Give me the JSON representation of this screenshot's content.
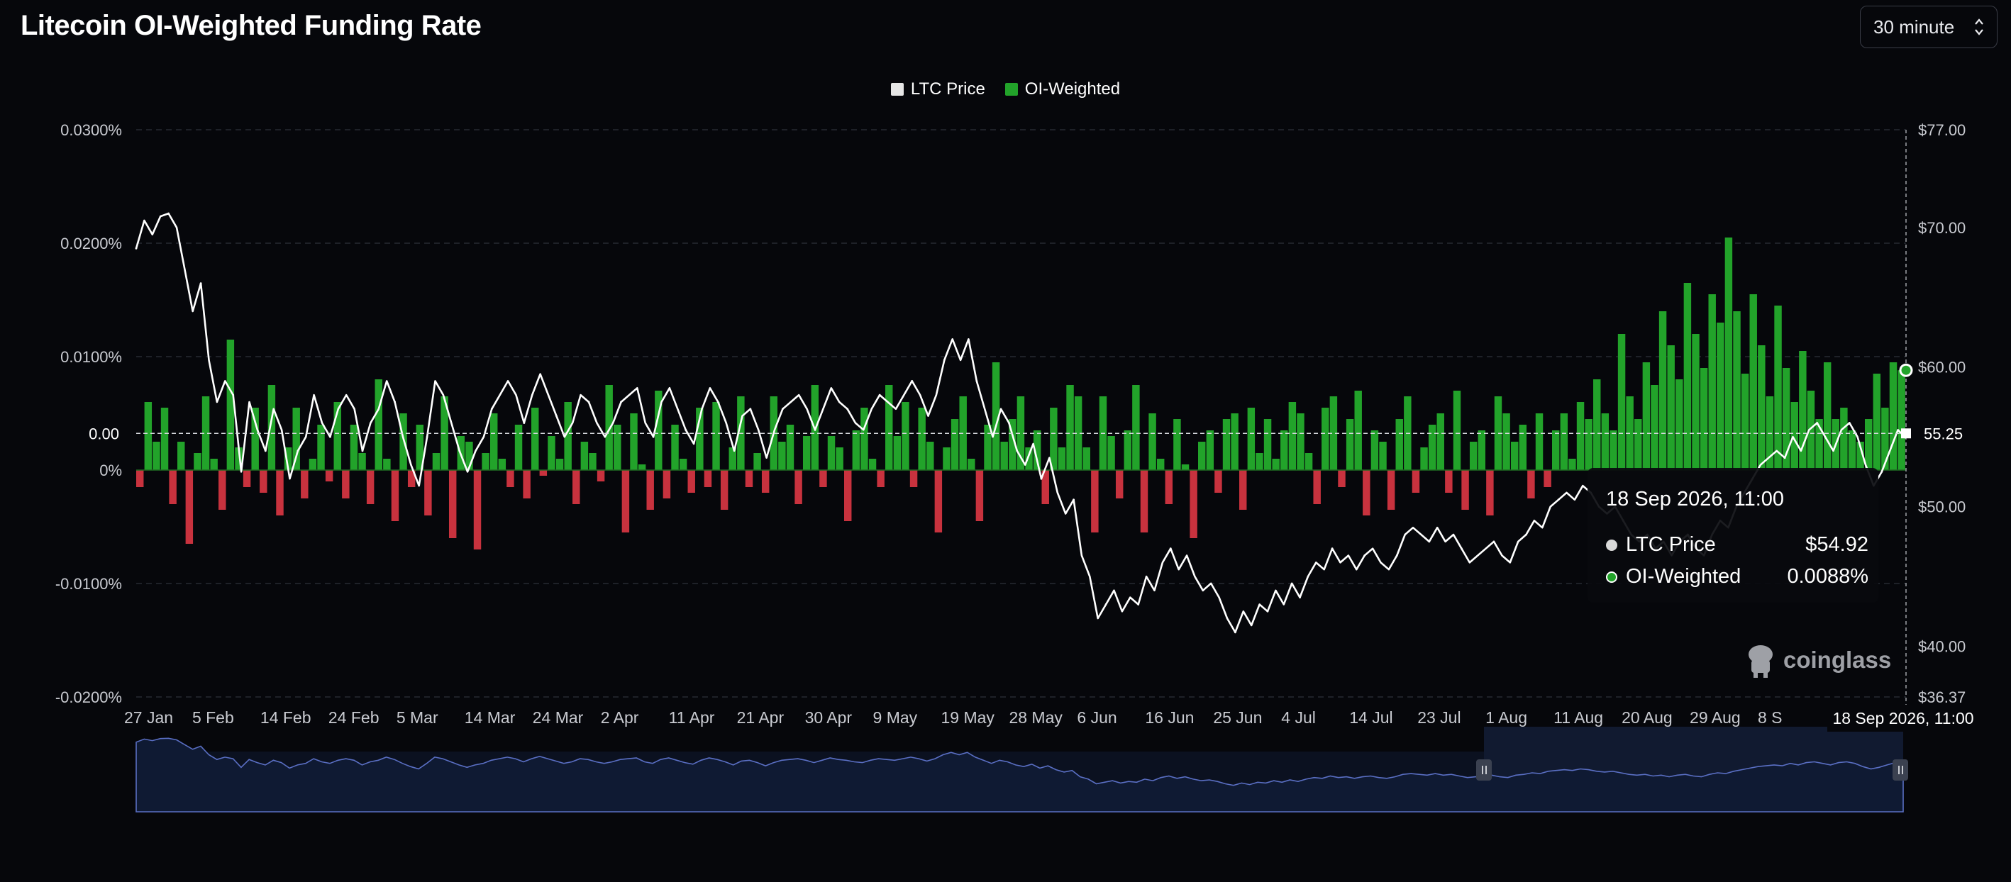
{
  "title": "Litecoin OI-Weighted Funding Rate",
  "interval_selector": {
    "value": "30 minute"
  },
  "legend": [
    {
      "label": "LTC Price",
      "color": "#e6e6e6"
    },
    {
      "label": "OI-Weighted",
      "color": "#22a32a"
    }
  ],
  "tooltip": {
    "title": "18 Sep 2026, 11:00",
    "rows": [
      {
        "name": "LTC Price",
        "value": "$54.92",
        "color": "#d9d9d9"
      },
      {
        "name": "OI-Weighted",
        "value": "0.0088%",
        "color": "#22a32a"
      }
    ]
  },
  "crosshair": {
    "x_label": "18 Sep 2026, 11:00",
    "left_axis_value": "0.00",
    "right_axis_value": "55.25"
  },
  "watermark": "coinglass",
  "colors": {
    "positive": "#22a32a",
    "negative": "#c8323e",
    "price_line": "#ffffff",
    "navigator": "#5a6fc4",
    "background": "#06070b"
  },
  "chart_data": {
    "type": "bar",
    "title": "Litecoin OI-Weighted Funding Rate",
    "x_tick_labels": [
      "27 Jan",
      "5 Feb",
      "14 Feb",
      "24 Feb",
      "5 Mar",
      "14 Mar",
      "24 Mar",
      "2 Apr",
      "11 Apr",
      "21 Apr",
      "30 Apr",
      "9 May",
      "19 May",
      "28 May",
      "6 Jun",
      "16 Jun",
      "25 Jun",
      "4 Jul",
      "14 Jul",
      "23 Jul",
      "1 Aug",
      "11 Aug",
      "20 Aug",
      "29 Aug",
      "8 S"
    ],
    "left_axis": {
      "ticks": [
        "0.0300%",
        "0.0200%",
        "0.0100%",
        "0%",
        "-0.0100%",
        "-0.0200%"
      ],
      "tick_values": [
        0.03,
        0.02,
        0.01,
        0,
        -0.01,
        -0.02
      ],
      "ylim": [
        -0.02,
        0.03
      ],
      "unit": "%"
    },
    "right_axis": {
      "ticks": [
        "$77.00",
        "$70.00",
        "$60.00",
        "$50.00",
        "$40.00",
        "$36.37"
      ],
      "tick_values": [
        77,
        70,
        60,
        50,
        40,
        36.37
      ],
      "ylim": [
        36.37,
        77
      ]
    },
    "grid": true,
    "legend_position": "top-center",
    "series": [
      {
        "name": "OI-Weighted",
        "axis": "left",
        "type": "bar",
        "x_range": [
          "27 Jan 2026",
          "18 Sep 2026"
        ],
        "values": [
          -0.0015,
          0.006,
          0.0025,
          0.0055,
          -0.003,
          0.0025,
          -0.0065,
          0.0015,
          0.0065,
          0.001,
          -0.0035,
          0.0115,
          0.002,
          -0.0015,
          0.0055,
          -0.002,
          0.0075,
          -0.004,
          0.002,
          0.0055,
          -0.0025,
          0.001,
          0.004,
          -0.001,
          0.006,
          -0.0025,
          0.004,
          0.0015,
          -0.003,
          0.008,
          0.001,
          -0.0045,
          0.005,
          -0.0015,
          0.004,
          -0.004,
          0.0015,
          0.0065,
          -0.006,
          0.003,
          0.0025,
          -0.007,
          0.0015,
          0.005,
          0.001,
          -0.0015,
          0.004,
          -0.0025,
          0.0055,
          -0.0005,
          0.003,
          0.001,
          0.006,
          -0.003,
          0.0025,
          0.0015,
          -0.001,
          0.0075,
          0.004,
          -0.0055,
          0.005,
          0.0005,
          -0.0035,
          0.007,
          -0.0025,
          0.004,
          0.001,
          -0.002,
          0.0055,
          -0.0015,
          0.006,
          -0.0035,
          0.002,
          0.0065,
          -0.0015,
          0.0015,
          -0.002,
          0.0065,
          0.0025,
          0.004,
          -0.003,
          0.003,
          0.0075,
          -0.0015,
          0.003,
          0.002,
          -0.0045,
          0.0035,
          0.0055,
          0.001,
          -0.0015,
          0.0075,
          0.003,
          0.006,
          -0.0015,
          0.0055,
          0.0025,
          -0.0055,
          0.002,
          0.0045,
          0.0065,
          0.001,
          -0.0045,
          0.004,
          0.0095,
          0.0025,
          0.0045,
          0.0065,
          0.002,
          0.0035,
          -0.003,
          0.0055,
          0.002,
          0.0075,
          0.0065,
          0.002,
          -0.0055,
          0.0065,
          0.003,
          -0.0025,
          0.0035,
          0.0075,
          -0.0055,
          0.005,
          0.001,
          -0.003,
          0.0045,
          0.0005,
          -0.006,
          0.0025,
          0.0035,
          -0.002,
          0.0045,
          0.005,
          -0.0035,
          0.0055,
          0.0015,
          0.0045,
          0.001,
          0.0035,
          0.006,
          0.005,
          0.0015,
          -0.003,
          0.0055,
          0.0065,
          -0.0015,
          0.0045,
          0.007,
          -0.004,
          0.0035,
          0.0025,
          -0.0035,
          0.0045,
          0.0065,
          -0.002,
          0.002,
          0.004,
          0.005,
          -0.002,
          0.007,
          -0.0035,
          0.0025,
          0.0035,
          -0.004,
          0.0065,
          0.005,
          0.0025,
          0.004,
          -0.0025,
          0.005,
          -0.0015,
          0.0035,
          0.005,
          0.001,
          0.006,
          0.0045,
          0.008,
          0.005,
          0.0035,
          0.012,
          0.0065,
          0.0045,
          0.0095,
          0.0075,
          0.014,
          0.011,
          0.008,
          0.0165,
          0.012,
          0.009,
          0.0155,
          0.013,
          0.0205,
          0.014,
          0.0085,
          0.0155,
          0.011,
          0.0065,
          0.0145,
          0.009,
          0.006,
          0.0105,
          0.007,
          0.0045,
          0.0095,
          0.0045,
          0.0055,
          0.0035,
          0.0025,
          0.0045,
          0.0085,
          0.0055,
          0.0095,
          0.0088
        ]
      },
      {
        "name": "LTC Price",
        "axis": "right",
        "type": "line",
        "values": [
          68.5,
          70.5,
          69.5,
          70.8,
          71,
          70,
          67,
          64,
          66,
          60.5,
          57.5,
          59,
          58,
          52.5,
          57.5,
          55.5,
          54,
          57,
          55.5,
          52,
          54,
          55,
          58,
          56,
          55,
          57,
          58,
          57,
          54,
          56,
          57,
          59,
          57.5,
          55,
          53,
          51.5,
          55,
          59,
          58,
          56,
          54,
          52.5,
          54,
          55,
          57,
          58,
          59,
          58,
          56,
          58,
          59.5,
          58,
          56.5,
          55,
          56,
          58,
          57.5,
          56,
          55,
          56,
          57.5,
          58,
          58.5,
          56,
          55,
          57.5,
          58.5,
          57,
          55.5,
          54.5,
          57,
          58.5,
          57.5,
          56,
          54,
          56.5,
          57,
          55.5,
          53.5,
          55.5,
          57,
          57.5,
          58,
          57,
          55.5,
          57,
          58.5,
          57.5,
          57,
          56,
          55.5,
          57,
          58,
          57.5,
          57,
          58,
          59,
          58,
          56.5,
          58,
          60.5,
          62,
          60.5,
          62,
          59,
          57,
          55,
          57,
          56,
          54,
          53,
          54.5,
          52,
          53.5,
          51,
          49.5,
          50.5,
          46.5,
          45,
          42,
          43,
          44,
          42.5,
          43.5,
          43,
          45,
          44,
          46,
          47,
          45.5,
          46.5,
          45,
          44,
          44.5,
          43.5,
          42,
          41,
          42.5,
          41.5,
          43,
          42.5,
          44,
          43,
          44.5,
          43.5,
          45,
          46,
          45.5,
          47,
          46,
          46.5,
          45.5,
          46.5,
          47,
          46,
          45.5,
          46.5,
          48,
          48.5,
          48,
          47.5,
          48.5,
          47.5,
          48,
          47,
          46,
          46.5,
          47,
          47.5,
          46.5,
          46,
          47.5,
          48,
          49,
          48.5,
          50,
          50.5,
          51,
          50.5,
          51.5,
          51,
          50,
          49.5,
          50,
          49,
          48,
          47.5,
          48,
          47,
          47.5,
          46.5,
          47.5,
          48,
          47,
          46.5,
          48,
          49,
          48.5,
          50,
          51,
          52,
          53,
          53.5,
          54,
          53.5,
          55,
          54,
          55.5,
          56,
          55,
          54,
          55.5,
          56,
          55,
          53,
          51.5,
          52.5,
          54,
          55.5,
          54.9
        ]
      }
    ]
  }
}
